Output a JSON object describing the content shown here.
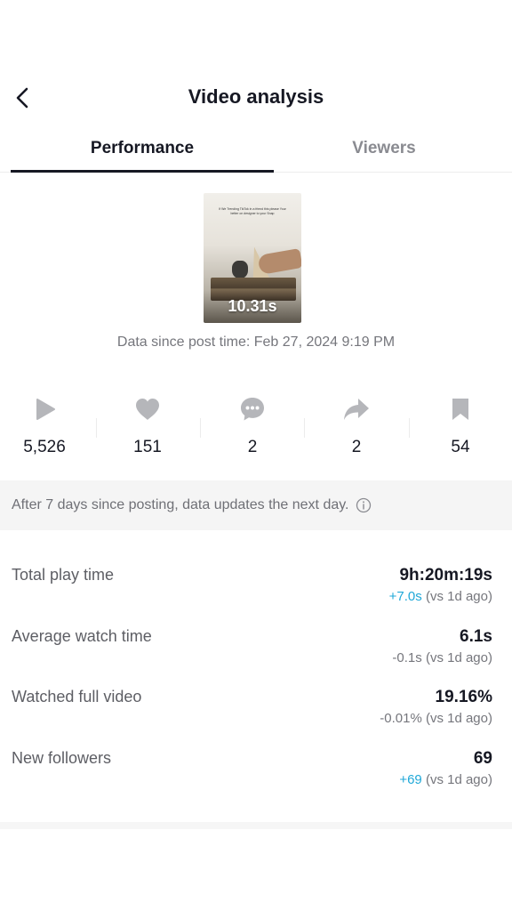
{
  "header": {
    "title": "Video analysis",
    "back_icon": "chevron-left-icon"
  },
  "tabs": [
    {
      "label": "Performance",
      "active": true
    },
    {
      "label": "Viewers",
      "active": false
    }
  ],
  "video": {
    "duration": "10.31s",
    "caption_text": "If We Trending TikTok in a friend this please Your better on designer to your Snap"
  },
  "data_since": "Data since post time: Feb 27, 2024 9:19 PM",
  "stats": [
    {
      "icon": "play-icon",
      "value": "5,526"
    },
    {
      "icon": "heart-icon",
      "value": "151"
    },
    {
      "icon": "comment-icon",
      "value": "2"
    },
    {
      "icon": "share-icon",
      "value": "2"
    },
    {
      "icon": "bookmark-icon",
      "value": "54"
    }
  ],
  "notice": {
    "text": "After 7 days since posting, data updates the next day.",
    "icon": "info-icon"
  },
  "metrics": [
    {
      "label": "Total play time",
      "value": "9h:20m:19s",
      "delta": "+7.0s",
      "delta_suffix": " (vs 1d ago)",
      "delta_positive": true
    },
    {
      "label": "Average watch time",
      "value": "6.1s",
      "delta": "-0.1s",
      "delta_suffix": " (vs 1d ago)",
      "delta_positive": false
    },
    {
      "label": "Watched full video",
      "value": "19.16%",
      "delta": "-0.01%",
      "delta_suffix": " (vs 1d ago)",
      "delta_positive": false
    },
    {
      "label": "New followers",
      "value": "69",
      "delta": "+69",
      "delta_suffix": " (vs 1d ago)",
      "delta_positive": true
    }
  ],
  "colors": {
    "text_primary": "#161823",
    "text_secondary": "#75767c",
    "icon_gray": "#b5b6ba",
    "positive_delta": "#20a8d8",
    "notice_bg": "#f5f5f5"
  }
}
